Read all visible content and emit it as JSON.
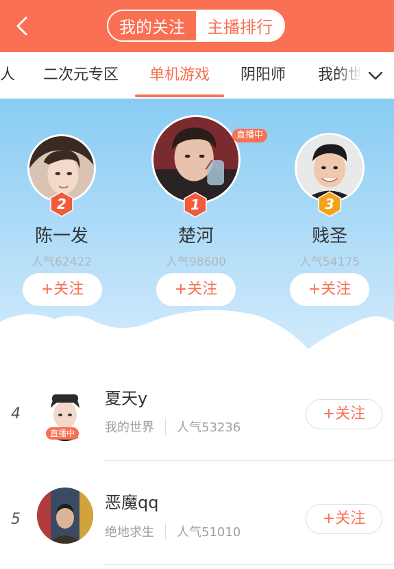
{
  "header": {
    "segments": [
      {
        "label": "我的关注",
        "active": false
      },
      {
        "label": "主播排行",
        "active": true
      }
    ]
  },
  "tabs": [
    {
      "label": "人",
      "active": false
    },
    {
      "label": "二次元专区",
      "active": false
    },
    {
      "label": "单机游戏",
      "active": true
    },
    {
      "label": "阴阳师",
      "active": false
    },
    {
      "label": "我的世",
      "active": false
    }
  ],
  "top3": [
    {
      "rank": "2",
      "name": "陈一发",
      "popularity": "人气62422",
      "follow": "+关注",
      "live": false
    },
    {
      "rank": "1",
      "name": "楚河",
      "popularity": "人气98600",
      "follow": "+关注",
      "live": true,
      "live_label": "直播中"
    },
    {
      "rank": "3",
      "name": "贱圣",
      "popularity": "人气54175",
      "follow": "+关注",
      "live": false
    }
  ],
  "list": [
    {
      "rank": "4",
      "name": "夏天y",
      "game": "我的世界",
      "popularity": "人气53236",
      "follow": "+关注",
      "live": true,
      "live_label": "直播中"
    },
    {
      "rank": "5",
      "name": "恶魔qq",
      "game": "绝地求生",
      "popularity": "人气51010",
      "follow": "+关注",
      "live": false
    }
  ],
  "colors": {
    "accent": "#f97052",
    "sky_top": "#88ccf3",
    "sky_bottom": "#d4ebfc",
    "badge_red": "#f15a3a",
    "badge_orange": "#f4a21c"
  },
  "icons": {
    "back": "chevron-left-icon",
    "more": "chevron-down-icon",
    "rank_badge": "hexagon-badge-icon"
  }
}
